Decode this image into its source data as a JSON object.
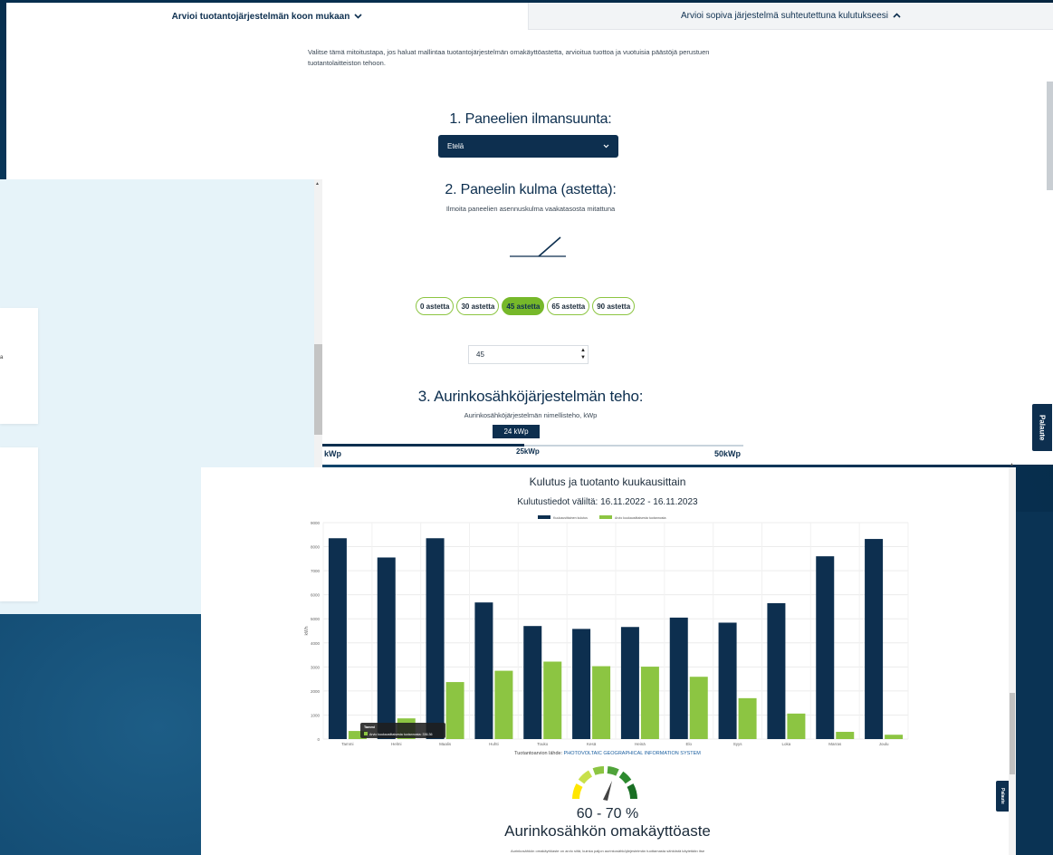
{
  "tabs": {
    "active": "Arvioi tuotantojärjestelmän koon mukaan",
    "inactive": "Arvioi sopiva järjestelmä suhteutettuna kulutukseesi"
  },
  "intro": "Valitse tämä mitoitustapa, jos haluat mallintaa tuotantojärjestelmän omakäyttöastetta, arvioitua tuottoa ja vuotuisia päästöjä perustuen tuotantolaitteiston tehoon.",
  "section1": {
    "title": "1. Paneelien ilmansuunta:",
    "selected": "Etelä"
  },
  "section2": {
    "title": "2. Paneelin kulma (astetta):",
    "subtitle": "Ilmoita paneelien asennuskulma vaakatasosta mitattuna",
    "options": [
      "0 astetta",
      "30 astetta",
      "45 astetta",
      "65 astetta",
      "90 astetta"
    ],
    "active_index": 2,
    "value": "45"
  },
  "section3": {
    "title": "3. Aurinkosähköjärjestelmän teho:",
    "subtitle": "Aurinkosähköjärjestelmän nimellisteho, kWp",
    "value": "24 kWp",
    "slider_labels": [
      "kWp",
      "25kWp",
      "50kWp"
    ],
    "slider_fraction": 0.48
  },
  "card_snippet": "a",
  "feedback_label": "Palaute",
  "chart": {
    "title": "Kulutus ja tuotanto kuukausittain",
    "subtitle": "Kulutustiedot väliltä: 16.11.2022 - 16.11.2023",
    "source_prefix": "Tuotantoarvion lähde:",
    "source_link": "PHOTOVOLTAIC GEOGRAPHICAL INFORMATION SYSTEM",
    "tooltip_title": "Tammi",
    "tooltip_value": "Arvio kuukausittaisesta tuotannosta: 336.36"
  },
  "chart_data": {
    "type": "bar",
    "categories": [
      "Tammi",
      "Helmi",
      "Maalis",
      "Huhti",
      "Touko",
      "Kesä",
      "Heinä",
      "Elo",
      "Syys",
      "Loka",
      "Marras",
      "Joulu"
    ],
    "series": [
      {
        "name": "Kuukausittainen kulutus",
        "values": [
          8350,
          7550,
          8350,
          5680,
          4700,
          4580,
          4660,
          5050,
          4840,
          5650,
          7600,
          8320
        ]
      },
      {
        "name": "Arvio kuukausittaisesta tuotannosta",
        "values": [
          336,
          860,
          2370,
          2840,
          3220,
          3030,
          3010,
          2590,
          1700,
          1060,
          300,
          180
        ]
      }
    ],
    "ylabel": "kWh",
    "ylim": [
      0,
      9000
    ],
    "yticks": [
      0,
      1000,
      2000,
      3000,
      4000,
      5000,
      6000,
      7000,
      8000,
      9000
    ],
    "colors": {
      "kulutus": "#0d2f4f",
      "tuotanto": "#8cc542"
    },
    "legend": "top-center",
    "grid": true
  },
  "gauge": {
    "value": "60 - 70 %",
    "title": "Aurinkosähkön omakäyttöaste",
    "description": "Aurinkosähkön omakäyttöaste on arvio siitä, kuinka paljon aurinkosähköjärjestelmän tuottamasta sähköstä käytetään itse"
  }
}
